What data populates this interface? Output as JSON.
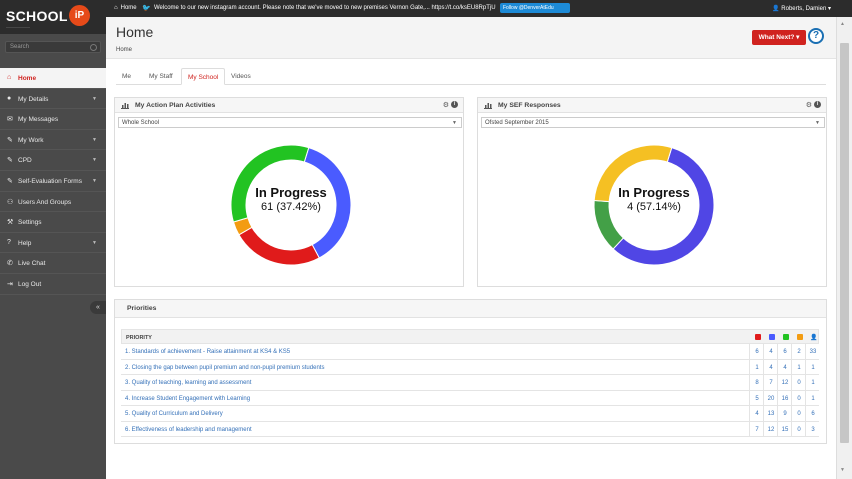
{
  "brand": {
    "word": "SCHOOL",
    "ip": "iP",
    "tagline": "————————"
  },
  "search": {
    "placeholder": "Search"
  },
  "sidebar": {
    "items": [
      {
        "label": "Home",
        "icon": "home-icon",
        "chevron": false,
        "active": true
      },
      {
        "label": "My Details",
        "icon": "user-icon",
        "chevron": true
      },
      {
        "label": "My Messages",
        "icon": "envelope-icon",
        "chevron": false
      },
      {
        "label": "My Work",
        "icon": "pencil-icon",
        "chevron": true
      },
      {
        "label": "CPD",
        "icon": "pencil-icon",
        "chevron": true
      },
      {
        "label": "Self-Evaluation Forms",
        "icon": "pencil-icon",
        "chevron": true
      },
      {
        "label": "Users And Groups",
        "icon": "users-icon",
        "chevron": false
      },
      {
        "label": "Settings",
        "icon": "wrench-icon",
        "chevron": false
      },
      {
        "label": "Help",
        "icon": "help-icon",
        "chevron": true
      },
      {
        "label": "Live Chat",
        "icon": "chat-icon",
        "chevron": false
      },
      {
        "label": "Log Out",
        "icon": "logout-icon",
        "chevron": false
      }
    ]
  },
  "topbar": {
    "home": "Home",
    "message": "Welcome to our new instagram account. Please note that we've moved to new premises Vernon Gate,... https://t.co/ksEU8RpTjU",
    "follow": "Follow @DenverAtEdu",
    "user": "Roberts, Damien"
  },
  "page": {
    "title": "Home",
    "breadcrumb": "Home",
    "what_next": "What Next?",
    "help": "?"
  },
  "tabs": [
    "Me",
    "My Staff",
    "My School",
    "Videos"
  ],
  "panels": {
    "action": {
      "title": "My Action Plan Activities",
      "select": "Whole School",
      "center_title": "In Progress",
      "center_value": "61 (37.42%)"
    },
    "sef": {
      "title": "My SEF Responses",
      "select": "Ofsted September 2015",
      "center_title": "In Progress",
      "center_value": "4 (57.14%)"
    }
  },
  "chart_data": [
    {
      "type": "pie",
      "title": "My Action Plan Activities",
      "slices": [
        {
          "color": "#4a5bff",
          "value": 61
        },
        {
          "color": "#e01b1b",
          "value": 40
        },
        {
          "color": "#f39c12",
          "value": 6
        },
        {
          "color": "#22c322",
          "value": 56
        }
      ],
      "highlight": {
        "label": "In Progress",
        "value": 61,
        "percent": 37.42
      }
    },
    {
      "type": "pie",
      "title": "My SEF Responses",
      "slices": [
        {
          "color": "#5046e5",
          "value": 4
        },
        {
          "color": "#43a047",
          "value": 1
        },
        {
          "color": "#f5c023",
          "value": 2
        }
      ],
      "highlight": {
        "label": "In Progress",
        "value": 4,
        "percent": 57.14
      }
    }
  ],
  "priorities": {
    "title": "Priorities",
    "header": "PRIORITY",
    "column_colors": [
      "#e01b1b",
      "#4a5bff",
      "#22c322",
      "#f39c12"
    ],
    "rows": [
      {
        "name": "1. Standards of achievement - Raise attainment at KS4 & KS5",
        "counts": [
          "6",
          "4",
          "6",
          "2",
          "33"
        ]
      },
      {
        "name": "2. Closing the gap between pupil premium and non-pupil premium students",
        "counts": [
          "1",
          "4",
          "4",
          "1",
          "1"
        ]
      },
      {
        "name": "3. Quality of teaching, learning and assessment",
        "counts": [
          "8",
          "7",
          "12",
          "0",
          "1"
        ]
      },
      {
        "name": "4. Increase Student Engagement with Learning",
        "counts": [
          "5",
          "20",
          "16",
          "0",
          "1"
        ]
      },
      {
        "name": "5. Quality of Curriculum and Delivery",
        "counts": [
          "4",
          "13",
          "9",
          "0",
          "6"
        ]
      },
      {
        "name": "6. Effectiveness of leadership and management",
        "counts": [
          "7",
          "12",
          "15",
          "0",
          "3"
        ]
      }
    ]
  }
}
